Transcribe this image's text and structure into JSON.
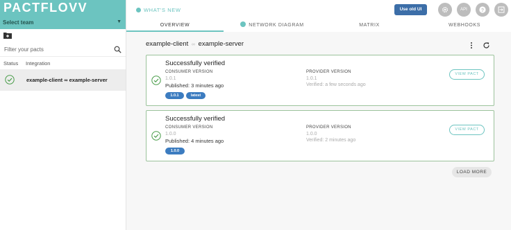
{
  "app": {
    "logo": "PACTFLOVV"
  },
  "sidebar": {
    "team_select": "Select team",
    "filter_placeholder": "Filter your pacts",
    "columns": {
      "status": "Status",
      "integration": "Integration"
    },
    "integrations": [
      {
        "name": "example-client ∞ example-server",
        "status_icon": "check-circle-icon"
      }
    ]
  },
  "topbar": {
    "whats_new": "WHAT'S NEW",
    "use_old_ui": "Use old UI",
    "api_label": "API"
  },
  "tabs": [
    {
      "label": "OVERVIEW",
      "active": true
    },
    {
      "label": "NETWORK DIAGRAM",
      "active": false
    },
    {
      "label": "MATRIX",
      "active": false
    },
    {
      "label": "WEBHOOKS",
      "active": false
    }
  ],
  "main": {
    "consumer": "example-client",
    "provider": "example-server",
    "link_symbol": "∞",
    "pacts": [
      {
        "status": "Successfully verified",
        "consumer_label": "CONSUMER VERSION",
        "consumer_version": "1.0.1",
        "published": "Published: 3 minutes ago",
        "tags": [
          "1.0.1",
          "latest"
        ],
        "provider_label": "PROVIDER VERSION",
        "provider_version": "1.0.1",
        "verified": "Verified: a few seconds ago",
        "view_label": "VIEW PACT"
      },
      {
        "status": "Successfully verified",
        "consumer_label": "CONSUMER VERSION",
        "consumer_version": "1.0.0",
        "published": "Published: 4 minutes ago",
        "tags": [
          "1.0.0"
        ],
        "provider_label": "PROVIDER VERSION",
        "provider_version": "1.0.0",
        "verified": "Verified: 2 minutes ago",
        "view_label": "VIEW PACT"
      }
    ],
    "load_more": "LOAD MORE"
  },
  "colors": {
    "brand": "#6cc4c0",
    "primary": "#3c6ea8",
    "success_border": "#9bc29b",
    "tag": "#3c7cc0"
  }
}
